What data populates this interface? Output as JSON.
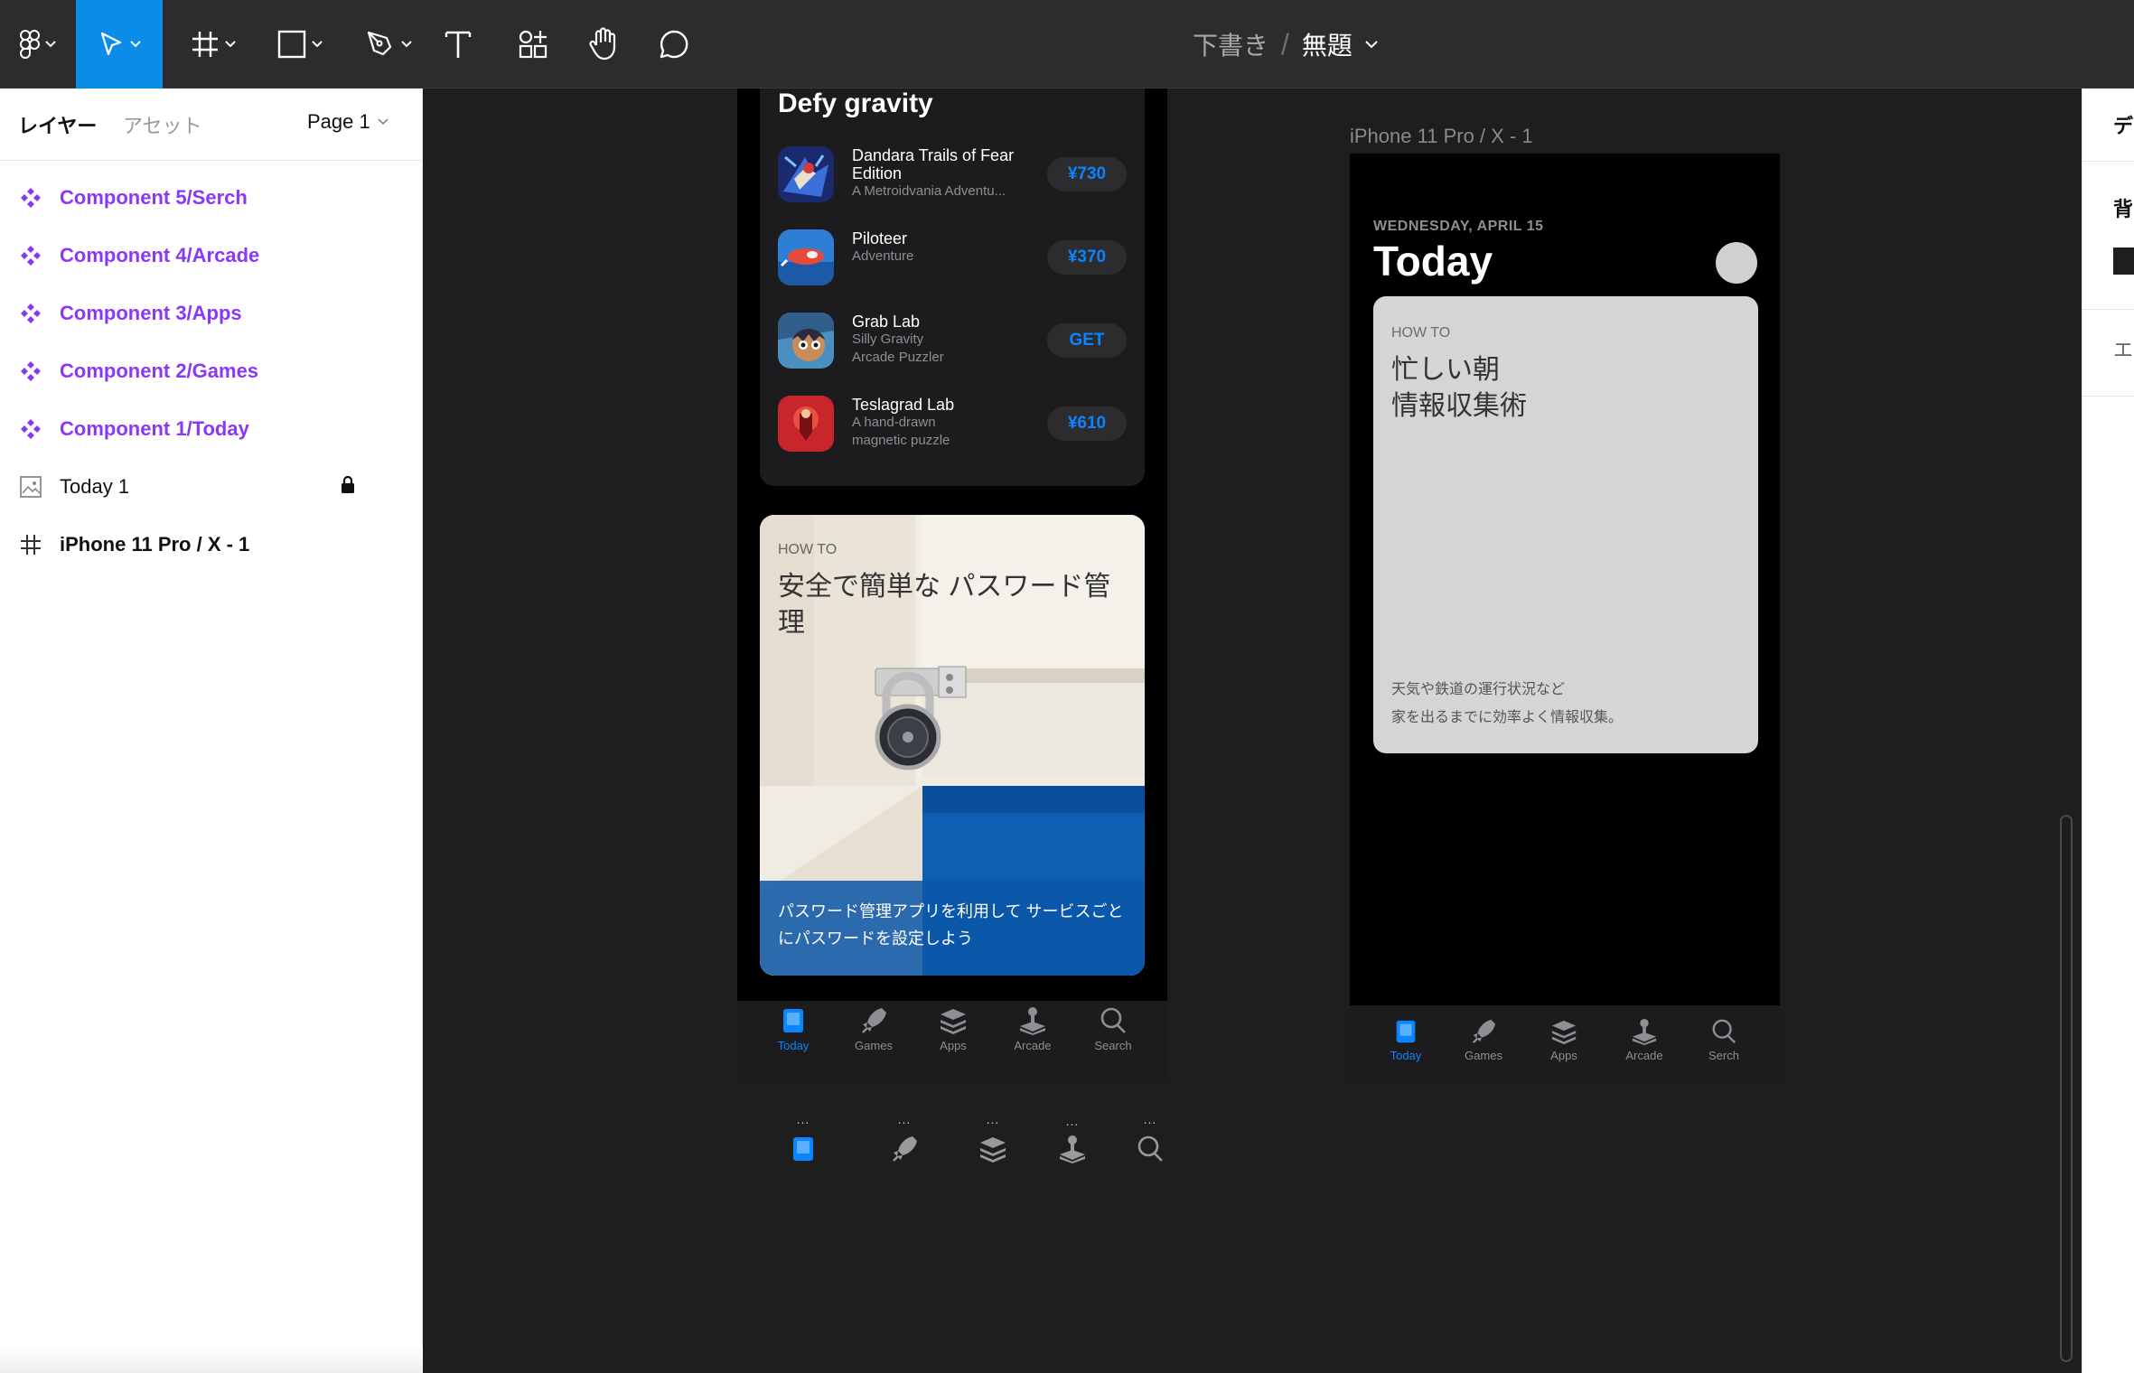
{
  "toolbar": {
    "tools": [
      "main-menu",
      "move",
      "frame",
      "shape",
      "pen",
      "text",
      "resources",
      "hand",
      "comment"
    ],
    "active_tool": "move",
    "file": {
      "draft_label": "下書き",
      "separator": "/",
      "name": "無題"
    }
  },
  "left_panel": {
    "tabs": {
      "layers": "レイヤー",
      "assets": "アセット"
    },
    "page": "Page 1",
    "layers": [
      {
        "label": "Component 5/Serch",
        "kind": "component"
      },
      {
        "label": "Component 4/Arcade",
        "kind": "component"
      },
      {
        "label": "Component 3/Apps",
        "kind": "component"
      },
      {
        "label": "Component 2/Games",
        "kind": "component"
      },
      {
        "label": "Component 1/Today",
        "kind": "component"
      },
      {
        "label": "Today 1",
        "kind": "image",
        "locked": true
      },
      {
        "label": "iPhone 11 Pro / X - 1",
        "kind": "frame"
      }
    ]
  },
  "frame_a": {
    "section_title": "Defy gravity",
    "apps": [
      {
        "name": "Dandara Trails of Fear Edition",
        "subtitle": "A Metroidvania Adventu...",
        "action": "¥730"
      },
      {
        "name": "Piloteer",
        "subtitle": "Adventure",
        "action": "¥370"
      },
      {
        "name": "Grab Lab",
        "subtitle": "Silly Gravity Arcade Puzzler",
        "action": "GET"
      },
      {
        "name": "Teslagrad Lab",
        "subtitle": "A hand-drawn magnetic puzzle",
        "action": "¥610"
      }
    ],
    "howto_card": {
      "kicker": "HOW TO",
      "title": "安全で簡単な パスワード管理",
      "caption": "パスワード管理アプリを利用して サービスごとにパスワードを設定しよう"
    },
    "tabbar": [
      {
        "label": "Today",
        "icon": "today-icon",
        "active": true
      },
      {
        "label": "Games",
        "icon": "rocket-icon",
        "active": false
      },
      {
        "label": "Apps",
        "icon": "layers-icon",
        "active": false
      },
      {
        "label": "Arcade",
        "icon": "joystick-icon",
        "active": false
      },
      {
        "label": "Search",
        "icon": "search-icon",
        "active": false
      }
    ]
  },
  "components_row": {
    "dots": "...",
    "icons": [
      "today-icon",
      "rocket-icon",
      "layers-icon",
      "joystick-icon",
      "search-icon"
    ]
  },
  "frame_b": {
    "label": "iPhone 11 Pro / X - 1",
    "date": "WEDNESDAY, APRIL 15",
    "title": "Today",
    "card": {
      "kicker": "HOW TO",
      "title_line1": "忙しい朝",
      "title_line2": "情報収集術",
      "caption_line1": "天気や鉄道の運行状況など",
      "caption_line2": "家を出るまでに効率よく情報収集。"
    },
    "tabbar": [
      {
        "label": "Today",
        "icon": "today-icon",
        "active": true
      },
      {
        "label": "Games",
        "icon": "rocket-icon",
        "active": false
      },
      {
        "label": "Apps",
        "icon": "layers-icon",
        "active": false
      },
      {
        "label": "Arcade",
        "icon": "joystick-icon",
        "active": false
      },
      {
        "label": "Serch",
        "icon": "search-icon",
        "active": false
      }
    ]
  },
  "right_panel": {
    "tab": "デ",
    "background_label": "背",
    "export_label": "エ"
  },
  "colors": {
    "accent": "#0c8ce9",
    "component": "#8a38f5",
    "ios_blue": "#0a84ff"
  }
}
